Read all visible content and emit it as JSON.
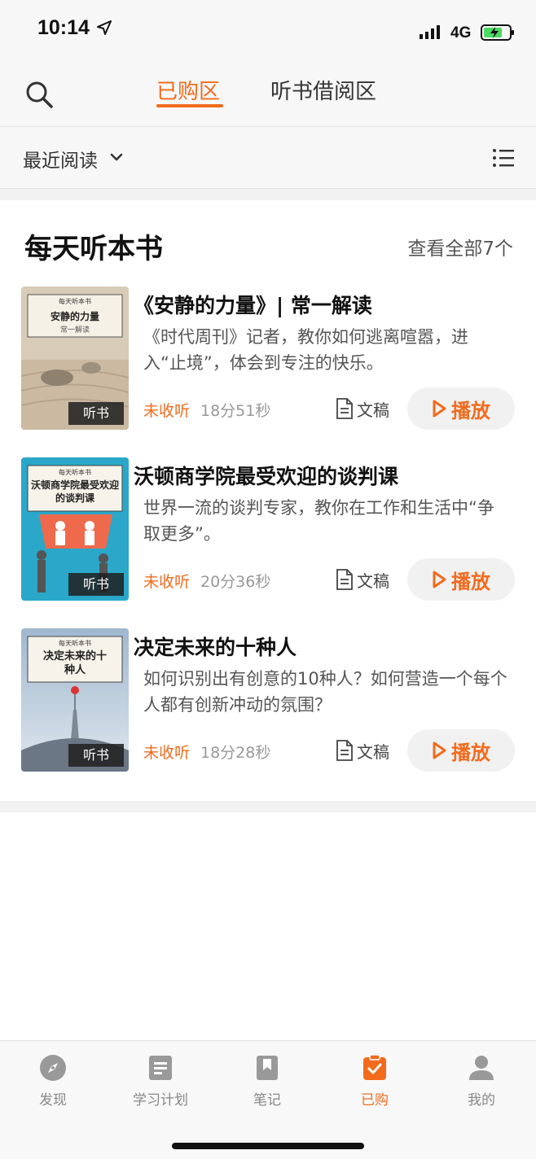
{
  "status_bar": {
    "time": "10:14",
    "network": "4G",
    "icons": [
      "location-arrow-icon",
      "signal-icon",
      "battery-charging-icon"
    ]
  },
  "top_nav": {
    "tabs": [
      {
        "label": "已购区",
        "active": true
      },
      {
        "label": "听书借阅区",
        "active": false
      }
    ],
    "search_icon": "search-icon"
  },
  "filter": {
    "label": "最近阅读",
    "dropdown_icon": "chevron-down-icon",
    "list_icon": "list-view-icon"
  },
  "section": {
    "title": "每天听本书",
    "view_all": "查看全部7个"
  },
  "books": [
    {
      "cover_series": "每天听本书",
      "cover_title": "安静的力量",
      "cover_author": "常一解读",
      "badge": "听书",
      "title": "《安静的力量》| 常一解读",
      "desc": "《时代周刊》记者，教你如何逃离喧嚣，进入“止境”，体会到专注的快乐。",
      "status": "未收听",
      "duration": "18分51秒",
      "doc_label": "文稿",
      "play_label": "播放"
    },
    {
      "cover_series": "每天听本书",
      "cover_title": "沃顿商学院最受欢迎的谈判课",
      "cover_author": "",
      "badge": "听书",
      "title": "沃顿商学院最受欢迎的谈判课",
      "desc": "世界一流的谈判专家，教你在工作和生活中“争取更多”。",
      "status": "未收听",
      "duration": "20分36秒",
      "doc_label": "文稿",
      "play_label": "播放"
    },
    {
      "cover_series": "每天听本书",
      "cover_title": "决定未来的十种人",
      "cover_author": "",
      "badge": "听书",
      "title": "决定未来的十种人",
      "desc": "如何识别出有创意的10种人？如何营造一个每个人都有创新冲动的氛围？",
      "status": "未收听",
      "duration": "18分28秒",
      "doc_label": "文稿",
      "play_label": "播放"
    }
  ],
  "tab_bar": [
    {
      "label": "发现",
      "icon": "compass-icon",
      "active": false
    },
    {
      "label": "学习计划",
      "icon": "plan-icon",
      "active": false
    },
    {
      "label": "笔记",
      "icon": "bookmark-icon",
      "active": false
    },
    {
      "label": "已购",
      "icon": "purchased-check-icon",
      "active": true
    },
    {
      "label": "我的",
      "icon": "profile-icon",
      "active": false
    }
  ],
  "colors": {
    "accent": "#f26b1d",
    "tab_inactive": "#888888",
    "background": "#ffffff"
  }
}
